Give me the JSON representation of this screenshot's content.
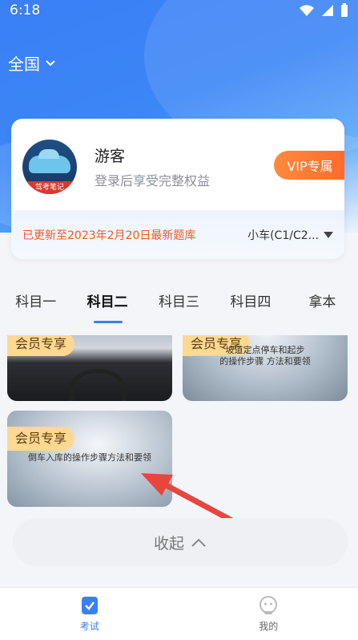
{
  "status_bar": {
    "time": "6:18"
  },
  "header": {
    "region": "全国"
  },
  "user": {
    "name": "游客",
    "subtitle": "登录后享受完整权益",
    "avatar_text": "驾考笔记",
    "vip_label": "VIP专属"
  },
  "update": {
    "text": "已更新至2023年2月20日最新题库",
    "car_type": "小车(C1/C2..."
  },
  "tabs": [
    {
      "label": "科目一"
    },
    {
      "label": "科目二"
    },
    {
      "label": "科目三"
    },
    {
      "label": "科目四"
    },
    {
      "label": "拿本"
    }
  ],
  "videos": [
    {
      "badge": "会员专享",
      "title": ""
    },
    {
      "badge": "会员专享",
      "title": "坡道定点停车和起步\n的操作步骤 方法和要领"
    },
    {
      "badge": "会员专享",
      "title": "倒车入库的操作步骤方法和要领"
    }
  ],
  "collapse": {
    "label": "收起"
  },
  "nav": [
    {
      "label": "考试"
    },
    {
      "label": "我的"
    }
  ],
  "colors": {
    "primary": "#3a7ff6",
    "vip": "#ff6a2a",
    "update_text": "#f05a22",
    "badge_bg": "#ffd891"
  }
}
